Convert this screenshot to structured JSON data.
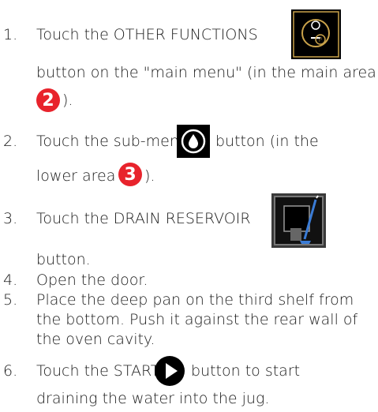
{
  "steps": [
    {
      "num": "1.",
      "pre": "Touch the OTHER FUNCTIONS",
      "line2": "button on the \"main menu\" (in the main area",
      "badge": "2",
      "tail": ")."
    },
    {
      "num": "2.",
      "pre": "Touch the sub-menu",
      "post": "button (in the",
      "line2": "lower area",
      "badge": "3",
      "tail": ")."
    },
    {
      "num": "3.",
      "pre": "Touch the DRAIN RESERVOIR",
      "line2": "button."
    },
    {
      "num": "4.",
      "text": "Open the door."
    },
    {
      "num": "5.",
      "line1": "Place the deep pan on the third shelf from",
      "line2": "the bottom. Push it against the rear wall of",
      "line3": "the oven cavity."
    },
    {
      "num": "6.",
      "pre": "Touch the START",
      "post": "button to start",
      "line2": "draining the water into the jug."
    }
  ],
  "colors": {
    "badge": "#e8232c",
    "icon_bg": "#000000",
    "icon_gold": "#c9a24a"
  },
  "icons": [
    "other-functions-icon",
    "water-drop-icon",
    "drain-reservoir-icon",
    "play-icon"
  ]
}
